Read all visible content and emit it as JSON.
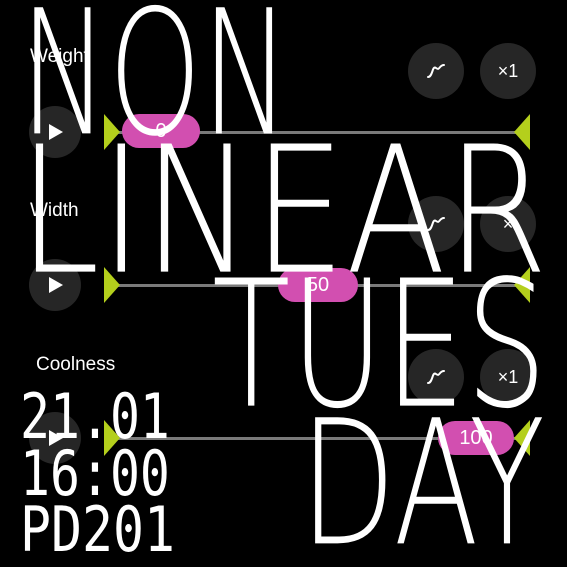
{
  "headline": {
    "line1": "NON",
    "line2": "LINEAR",
    "line3": "TUES",
    "line4": "DAY"
  },
  "event": {
    "date": "21.01",
    "time": "16:00",
    "room": "PD201"
  },
  "sliders": [
    {
      "label": "Weight",
      "value": "0",
      "value_fraction": 0.0,
      "multiplier": "×1"
    },
    {
      "label": "Width",
      "value": "50",
      "value_fraction": 0.5,
      "multiplier": "×"
    },
    {
      "label": "Coolness",
      "value": "100",
      "value_fraction": 1.0,
      "multiplier": "×1"
    }
  ],
  "colors": {
    "background": "#000000",
    "text": "#ffffff",
    "thumb": "#d24fb0",
    "marker": "#b4cf1c",
    "button": "#262626",
    "track": "#7a7a7a"
  },
  "icons": {
    "play": "play-icon",
    "curve": "curve-icon"
  }
}
